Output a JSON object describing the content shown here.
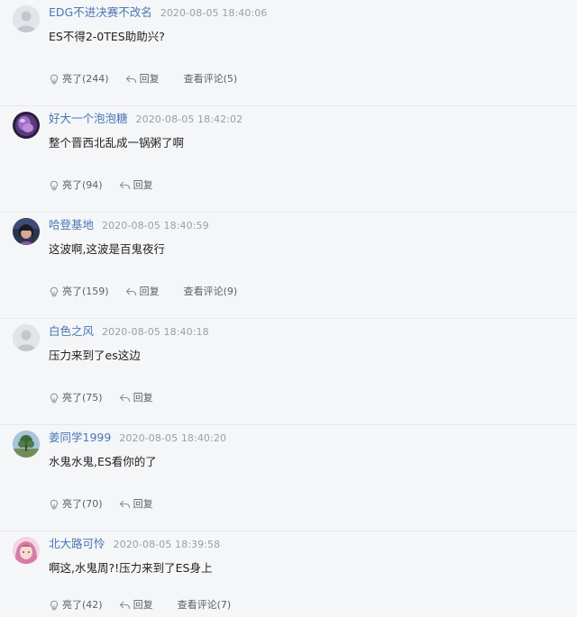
{
  "comments": [
    {
      "username": "EDG不进决赛不改名",
      "time": "2020-08-05 18:40:06",
      "content": "ES不得2-0TES助助兴?",
      "like_label": "亮了(244)",
      "reply_label": "回复",
      "view_label": "查看评论(5)",
      "avatar": "default-avatar-icon"
    },
    {
      "username": "好大一个泡泡糖",
      "time": "2020-08-05 18:42:02",
      "content": "整个晋西北乱成一锅粥了啊",
      "like_label": "亮了(94)",
      "reply_label": "回复",
      "view_label": "",
      "avatar": "purple-character-avatar"
    },
    {
      "username": "哈登基地",
      "time": "2020-08-05 18:40:59",
      "content": "这波啊,这波是百鬼夜行",
      "like_label": "亮了(159)",
      "reply_label": "回复",
      "view_label": "查看评论(9)",
      "avatar": "character-avatar"
    },
    {
      "username": "白色之风",
      "time": "2020-08-05 18:40:18",
      "content": "压力来到了es这边",
      "like_label": "亮了(75)",
      "reply_label": "回复",
      "view_label": "",
      "avatar": "default-avatar-icon"
    },
    {
      "username": "姜同学1999",
      "time": "2020-08-05 18:40:20",
      "content": "水鬼水鬼,ES看你的了",
      "like_label": "亮了(70)",
      "reply_label": "回复",
      "view_label": "",
      "avatar": "tree-landscape-avatar"
    },
    {
      "username": "北大路可怜",
      "time": "2020-08-05 18:39:58",
      "content": "啊这,水鬼周?!压力来到了ES身上",
      "like_label": "亮了(42)",
      "reply_label": "回复",
      "view_label": "查看评论(7)",
      "avatar": "pink-anime-avatar"
    }
  ],
  "colors": {
    "background": "#f5f6f8",
    "username": "#4a76b4",
    "timestamp": "#9a9ea6",
    "divider": "#e6e8ec",
    "action_text": "#5b5f66"
  }
}
